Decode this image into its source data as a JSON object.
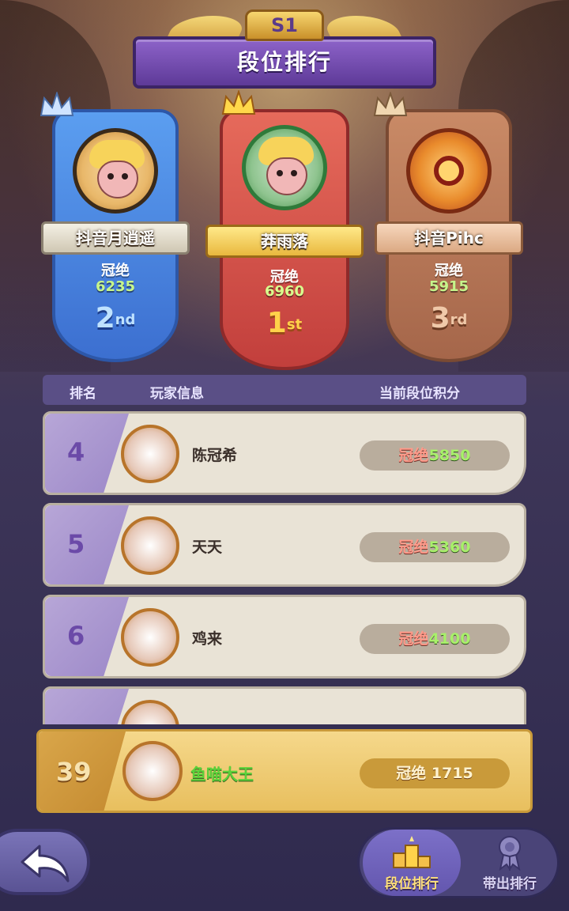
{
  "season": "S1",
  "title": "段位排行",
  "top3": [
    {
      "place_num": "2",
      "place_suffix": "nd",
      "name": "抖音月逍遥",
      "tier": "冠绝",
      "score": "6235"
    },
    {
      "place_num": "1",
      "place_suffix": "st",
      "name": "莽雨落",
      "tier": "冠绝",
      "score": "6960"
    },
    {
      "place_num": "3",
      "place_suffix": "rd",
      "name": "抖音Pihc",
      "tier": "冠绝",
      "score": "5915"
    }
  ],
  "header": {
    "rank": "排名",
    "player": "玩家信息",
    "points": "当前段位积分"
  },
  "rows": [
    {
      "rank": "4",
      "name": "陈冠希",
      "tier": "冠绝",
      "score": "5850"
    },
    {
      "rank": "5",
      "name": "天天",
      "tier": "冠绝",
      "score": "5360"
    },
    {
      "rank": "6",
      "name": "鸡来",
      "tier": "冠绝",
      "score": "4100"
    }
  ],
  "me": {
    "rank": "39",
    "name": "鱼喵大王",
    "tier": "冠绝",
    "score": "1715"
  },
  "tabs": {
    "ranking": "段位排行",
    "out": "带出排行"
  },
  "colors": {
    "gold": "#ffd24a",
    "score_green": "#a8f06a",
    "tier_red": "#ff9a8a",
    "panel_purple": "#5a4f86"
  }
}
